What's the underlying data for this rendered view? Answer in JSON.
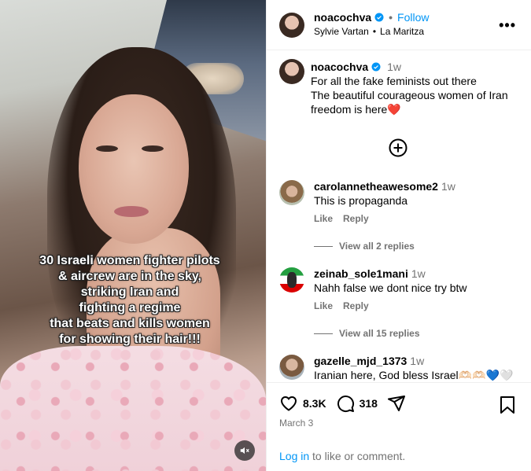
{
  "post": {
    "username": "noacochva",
    "follow_label": "Follow",
    "dot": "•",
    "audio_artist": "Sylvie Vartan",
    "audio_separator": "•",
    "audio_track": "La Maritza",
    "more_label": "•••"
  },
  "media": {
    "overlay_lines": [
      "30 Israeli women fighter pilots",
      "& aircrew are in the sky,",
      "striking Iran and",
      "fighting a regime",
      "that beats and kills women",
      "for showing their hair!!!"
    ],
    "mute_icon": "speaker-muted-icon"
  },
  "caption": {
    "username": "noacochva",
    "time": "1w",
    "lines": [
      "For all the fake feminists out there",
      "The beautiful courageous women of Iran",
      "freedom is here❤️"
    ]
  },
  "load_more_icon": "plus-circle-icon",
  "comments": [
    {
      "username": "carolannetheawesome2",
      "time": "1w",
      "text": "This is propaganda",
      "like_label": "Like",
      "reply_label": "Reply",
      "view_replies": "View all 2 replies"
    },
    {
      "username": "zeinab_sole1mani",
      "time": "1w",
      "text": "Nahh false we dont nice try btw",
      "like_label": "Like",
      "reply_label": "Reply",
      "view_replies": "View all 15 replies"
    },
    {
      "username": "gazelle_mjd_1373",
      "time": "1w",
      "text": "Iranian here, God bless Israel🫶🏻🫶🏻💙🤍"
    }
  ],
  "actions": {
    "like_count": "8.3K",
    "comment_count": "318",
    "date": "March 3",
    "login_link": "Log in",
    "login_suffix": " to like or comment."
  },
  "colors": {
    "link_blue": "#0095f6",
    "muted_gray": "#737373",
    "verified_blue": "#0095f6"
  }
}
